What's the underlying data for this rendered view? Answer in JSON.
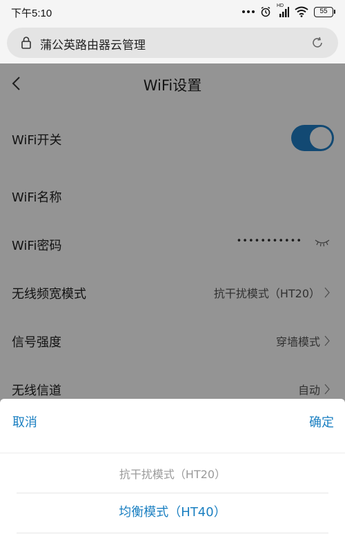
{
  "status_bar": {
    "time": "下午5:10",
    "network_badge": "HD",
    "battery": "55"
  },
  "url_bar": {
    "title": "蒲公英路由器云管理"
  },
  "nav": {
    "title": "WiFi设置"
  },
  "settings": {
    "wifi_switch_label": "WiFi开关",
    "wifi_switch_on": true,
    "wifi_name_label": "WiFi名称",
    "wifi_password_label": "WiFi密码",
    "wifi_password_mask": "•••••••••••",
    "bandwidth_label": "无线频宽模式",
    "bandwidth_value": "抗干扰模式（HT20）",
    "signal_label": "信号强度",
    "signal_value": "穿墙模式",
    "channel_label": "无线信道",
    "channel_value": "自动"
  },
  "picker": {
    "cancel": "取消",
    "confirm": "确定",
    "options": [
      "抗干扰模式（HT20）",
      "均衡模式（HT40）"
    ],
    "selected_index": 1
  },
  "colors": {
    "accent": "#1a7fc1",
    "toggle_on": "#1f7fc6"
  }
}
